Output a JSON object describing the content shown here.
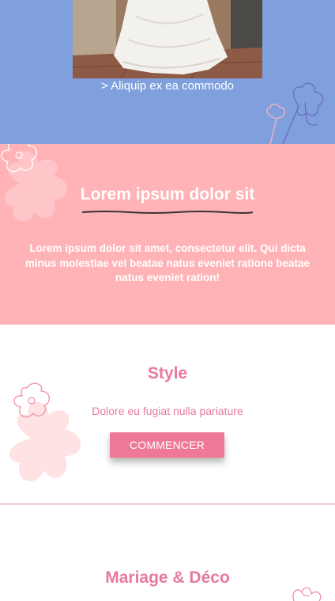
{
  "hero": {
    "image_alt": "wedding dress",
    "link_text": "> Aliquip ex ea commodo"
  },
  "intro": {
    "title": "Lorem ipsum dolor sit",
    "text": "Lorem ipsum dolor sit amet, consectetur elit. Qui dicta minus molestiae vel beatae natus eveniet ratione beatae natus eveniet ration!"
  },
  "style": {
    "title": "Style",
    "subtitle": "Dolore eu fugiat nulla pariature",
    "button_label": "COMMENCER"
  },
  "deco": {
    "title": "Mariage & Déco"
  },
  "colors": {
    "blue_bg": "#7fa0dc",
    "pink_bg": "#ffb3b6",
    "accent": "#ef7896",
    "text_pink": "#e77a9c"
  }
}
